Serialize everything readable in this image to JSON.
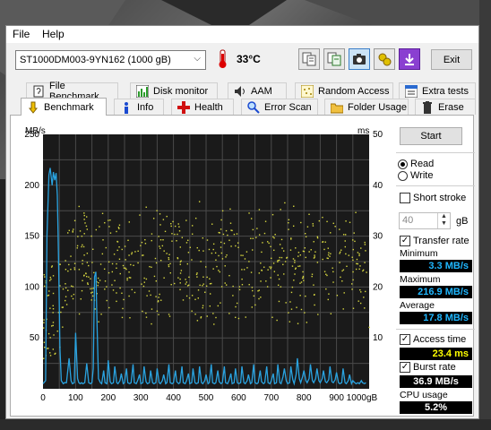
{
  "menu": {
    "file": "File",
    "help": "Help"
  },
  "toolbar": {
    "drive": "ST1000DM003-9YN162 (1000 gB)",
    "temperature": "33°C",
    "exit_label": "Exit",
    "buttons": [
      "copy-text-icon",
      "copy-info-icon",
      "screenshot-icon",
      "options-icon",
      "save-icon"
    ]
  },
  "tabs_row1": [
    {
      "label": "File Benchmark",
      "icon": "file-benchmark-icon"
    },
    {
      "label": "Disk monitor",
      "icon": "disk-monitor-icon"
    },
    {
      "label": "AAM",
      "icon": "speaker-icon"
    },
    {
      "label": "Random Access",
      "icon": "random-access-icon"
    },
    {
      "label": "Extra tests",
      "icon": "extra-tests-icon"
    }
  ],
  "tabs_row2": [
    {
      "label": "Benchmark",
      "icon": "benchmark-icon"
    },
    {
      "label": "Info",
      "icon": "info-icon"
    },
    {
      "label": "Health",
      "icon": "health-icon"
    },
    {
      "label": "Error Scan",
      "icon": "error-scan-icon"
    },
    {
      "label": "Folder Usage",
      "icon": "folder-icon"
    },
    {
      "label": "Erase",
      "icon": "erase-icon"
    }
  ],
  "side": {
    "start_label": "Start",
    "read_label": "Read",
    "write_label": "Write",
    "read_selected": true,
    "short_stroke_label": "Short stroke",
    "short_stroke_value": "40",
    "short_stroke_unit": "gB",
    "transfer_rate_label": "Transfer rate",
    "transfer_rate_checked": true,
    "minimum_label": "Minimum",
    "minimum_value": "3.3 MB/s",
    "maximum_label": "Maximum",
    "maximum_value": "216.9 MB/s",
    "average_label": "Average",
    "average_value": "17.8 MB/s",
    "access_time_label": "Access time",
    "access_time_value": "23.4 ms",
    "burst_rate_label": "Burst rate",
    "burst_rate_value": "36.9 MB/s",
    "cpu_usage_label": "CPU usage",
    "cpu_usage_value": "5.2%"
  },
  "chart_data": {
    "type": "line",
    "ylabel_left": "MB/s",
    "ylabel_right": "ms",
    "x_unit": "gB",
    "xlim": [
      0,
      1000
    ],
    "ylim_left": [
      0,
      250
    ],
    "ylim_right": [
      0,
      50
    ],
    "x_ticks": [
      "0",
      "100",
      "200",
      "300",
      "400",
      "500",
      "600",
      "700",
      "800",
      "900",
      "1000gB"
    ],
    "y_ticks_left": [
      "250",
      "200",
      "150",
      "100",
      "50"
    ],
    "y_ticks_right": [
      "50",
      "40",
      "30",
      "20",
      "10"
    ],
    "background": "#1a1a1a",
    "grid": true,
    "transfer_rate": {
      "name": "Transfer rate",
      "color": "#2aa3e0",
      "x": [
        0,
        8,
        12,
        18,
        22,
        28,
        32,
        36,
        40,
        44,
        48,
        52,
        56,
        62,
        66,
        72,
        80,
        86,
        90,
        96,
        100,
        106,
        110,
        114,
        118,
        122,
        128,
        134,
        140,
        146,
        150,
        154,
        158,
        162,
        166,
        170,
        176,
        180,
        186,
        190,
        196,
        200,
        206,
        210,
        216,
        220,
        226,
        230,
        236,
        240,
        246,
        250,
        256,
        260,
        266,
        270,
        276,
        280,
        286,
        290,
        296,
        300,
        306,
        310,
        316,
        320,
        326,
        330,
        336,
        340,
        346,
        350,
        356,
        360,
        366,
        370,
        376,
        380,
        386,
        390,
        396,
        400,
        406,
        410,
        416,
        420,
        426,
        430,
        436,
        440,
        446,
        450,
        456,
        460,
        466,
        470,
        476,
        480,
        486,
        490,
        496,
        500,
        506,
        510,
        516,
        520,
        526,
        530,
        536,
        540,
        546,
        550,
        556,
        560,
        566,
        570,
        576,
        580,
        586,
        590,
        596,
        600,
        606,
        610,
        616,
        620,
        626,
        630,
        636,
        640,
        646,
        650,
        656,
        660,
        666,
        670,
        676,
        680,
        686,
        690,
        696,
        700,
        706,
        710,
        716,
        720,
        726,
        730,
        736,
        740,
        746,
        750,
        756,
        760,
        766,
        770,
        776,
        780,
        786,
        790,
        796,
        800,
        806,
        810,
        816,
        820,
        826,
        830,
        836,
        840,
        846,
        850,
        856,
        860,
        866,
        870,
        876,
        880,
        886,
        890,
        896,
        900,
        906,
        910,
        916,
        920,
        926,
        930,
        936,
        940,
        946,
        950,
        956,
        960,
        966,
        970,
        976,
        980,
        986,
        990,
        996,
        1000
      ],
      "y": [
        5,
        8,
        150,
        210,
        217,
        200,
        213,
        205,
        212,
        190,
        120,
        40,
        8,
        5,
        6,
        6,
        30,
        8,
        5,
        6,
        55,
        10,
        6,
        5,
        6,
        5,
        6,
        25,
        6,
        5,
        6,
        20,
        110,
        115,
        60,
        10,
        6,
        5,
        18,
        6,
        5,
        28,
        7,
        5,
        6,
        22,
        6,
        5,
        8,
        15,
        5,
        6,
        20,
        6,
        5,
        6,
        24,
        6,
        5,
        8,
        14,
        5,
        6,
        22,
        7,
        5,
        6,
        18,
        6,
        5,
        6,
        20,
        6,
        5,
        8,
        14,
        5,
        6,
        24,
        6,
        5,
        6,
        18,
        7,
        5,
        6,
        22,
        6,
        5,
        8,
        15,
        5,
        6,
        20,
        6,
        5,
        6,
        22,
        6,
        5,
        8,
        14,
        5,
        6,
        24,
        6,
        5,
        6,
        18,
        7,
        5,
        6,
        22,
        6,
        5,
        8,
        15,
        5,
        6,
        20,
        6,
        5,
        6,
        22,
        6,
        5,
        8,
        14,
        5,
        6,
        24,
        6,
        5,
        6,
        18,
        7,
        5,
        6,
        22,
        6,
        5,
        8,
        15,
        5,
        6,
        24,
        6,
        5,
        12,
        20,
        8,
        5,
        6,
        22,
        9,
        5,
        14,
        30,
        10,
        6,
        12,
        18,
        8,
        6,
        10,
        24,
        8,
        6,
        10,
        20,
        8,
        6,
        10,
        18,
        7,
        6,
        9,
        22,
        7,
        6,
        9,
        16,
        6,
        5,
        6,
        20,
        6,
        5,
        8,
        14,
        5,
        8,
        6,
        5,
        6,
        5,
        8,
        6,
        5,
        6
      ]
    },
    "access_time": {
      "name": "Access time",
      "color": "#d8d840",
      "scatter_style": "points",
      "y_range_ms": [
        6,
        44
      ]
    }
  }
}
